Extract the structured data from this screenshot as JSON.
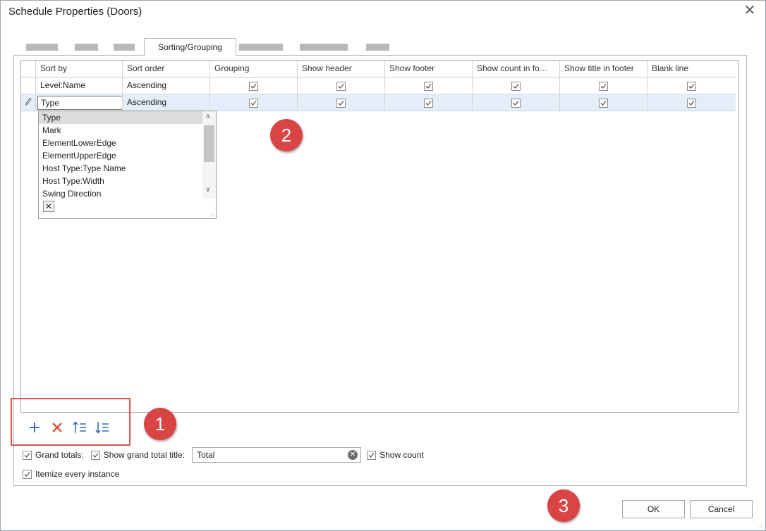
{
  "window": {
    "title": "Schedule Properties (Doors)"
  },
  "tabs": {
    "active_label": "Sorting/Grouping"
  },
  "grid": {
    "columns": [
      "Sort by",
      "Sort order",
      "Grouping",
      "Show header",
      "Show footer",
      "Show count in fo…",
      "Show title in footer",
      "Blank line"
    ],
    "rows": [
      {
        "sort_by": "Level:Name",
        "sort_order": "Ascending",
        "grouping": true,
        "show_header": true,
        "show_footer": true,
        "show_count": true,
        "show_title": true,
        "blank_line": true
      },
      {
        "sort_by": "Type",
        "sort_order": "Ascending",
        "grouping": true,
        "show_header": true,
        "show_footer": true,
        "show_count": true,
        "show_title": true,
        "blank_line": true
      }
    ]
  },
  "dropdown": {
    "items": [
      "Type",
      "Mark",
      "ElementLowerEdge",
      "ElementUpperEdge",
      "Host Type:Type Name",
      "Host Type:Width",
      "Swing Direction"
    ],
    "selected": "Type"
  },
  "toolbar": {
    "add_icon": "plus-icon",
    "delete_icon": "x-icon",
    "move_up_icon": "sort-up-icon",
    "move_down_icon": "sort-down-icon"
  },
  "options": {
    "grand_totals_label": "Grand totals:",
    "grand_totals_checked": true,
    "show_grand_total_title_label": "Show grand total title:",
    "show_grand_total_title_checked": true,
    "grand_total_title_value": "Total",
    "show_count_label": "Show count",
    "show_count_checked": true,
    "itemize_label": "Itemize every instance",
    "itemize_checked": true
  },
  "buttons": {
    "ok": "OK",
    "cancel": "Cancel"
  },
  "annotations": {
    "badge1": "1",
    "badge2": "2",
    "badge3": "3"
  },
  "colors": {
    "annotation_red": "#d94544",
    "selected_row": "#e3eef9",
    "toolbar_blue": "#3a6fb0",
    "delete_red": "#d9553c"
  }
}
